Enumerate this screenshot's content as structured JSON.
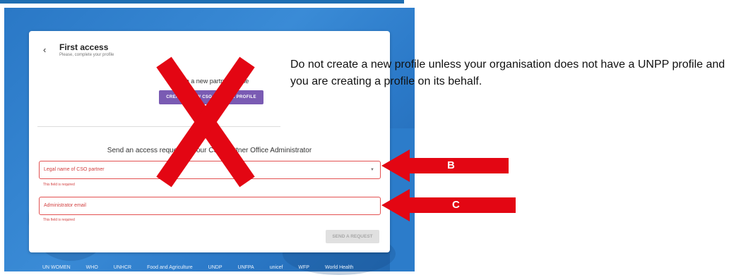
{
  "background": {
    "footer_logos": [
      "UN WOMEN",
      "WHO",
      "UNHCR",
      "Food and Agriculture",
      "UNDP",
      "UNFPA",
      "unicef",
      "WFP",
      "World Health"
    ]
  },
  "card": {
    "back_icon": "chevron-left-icon",
    "title": "First access",
    "subtitle": "Please, complete your profile",
    "create_profile_text": "Create a new partner profile",
    "create_profile_button": "CREATE A NEW CSO PARTNER PROFILE",
    "send_request_heading": "Send an access request to your CSO partner Office Administrator",
    "legal_name_placeholder": "Legal name of CSO partner",
    "legal_name_error": "This field is required",
    "admin_email_placeholder": "Administrator email",
    "admin_email_error": "This field is required",
    "send_request_button": "SEND A REQUEST"
  },
  "annotations": {
    "instruction": "Do not create a new profile unless your organisation does not have a UNPP profile and you are creating a profile on its behalf.",
    "arrow_b_label": "B",
    "arrow_c_label": "C",
    "accent_red": "#e30613"
  }
}
